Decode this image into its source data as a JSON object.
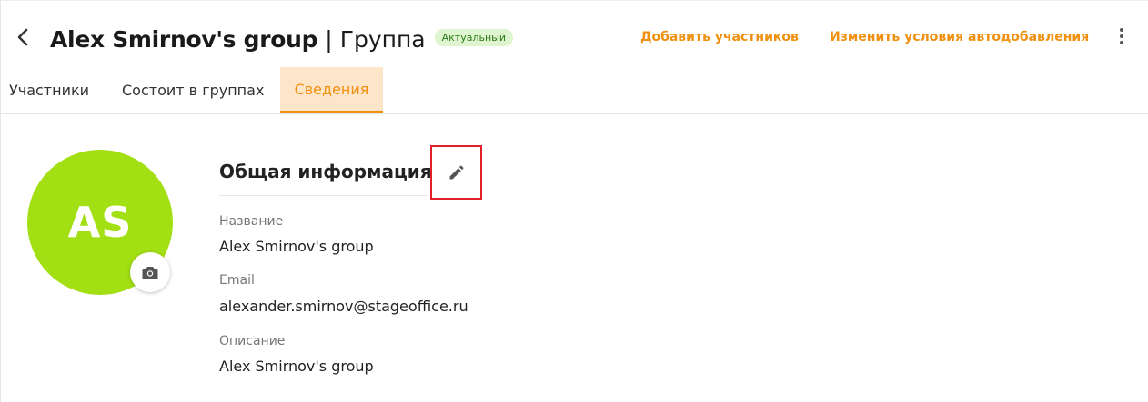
{
  "header": {
    "back_icon": "chevron-left-icon",
    "group_name": "Alex Smirnov's group",
    "separator": "|",
    "group_type": "Группа",
    "status": "Актуальный",
    "status_color": "#dff5cf",
    "add_members_label": "Добавить участников",
    "autoadd_label": "Изменить условия автодобавления",
    "more_icon": "more-vertical-icon",
    "accent_color": "#f0900e"
  },
  "tabs": [
    {
      "label": "Участники",
      "active": false
    },
    {
      "label": "Состоит в группах",
      "active": false
    },
    {
      "label": "Сведения",
      "active": true
    }
  ],
  "avatar": {
    "initials": "AS",
    "color": "#a2e014",
    "camera_icon": "camera-icon"
  },
  "info": {
    "section_title": "Общая информация",
    "edit_icon": "pencil-icon",
    "fields": [
      {
        "label": "Название",
        "value": "Alex Smirnov's group"
      },
      {
        "label": "Email",
        "value": "alexander.smirnov@stageoffice.ru"
      },
      {
        "label": "Описание",
        "value": "Alex Smirnov's group"
      }
    ]
  }
}
